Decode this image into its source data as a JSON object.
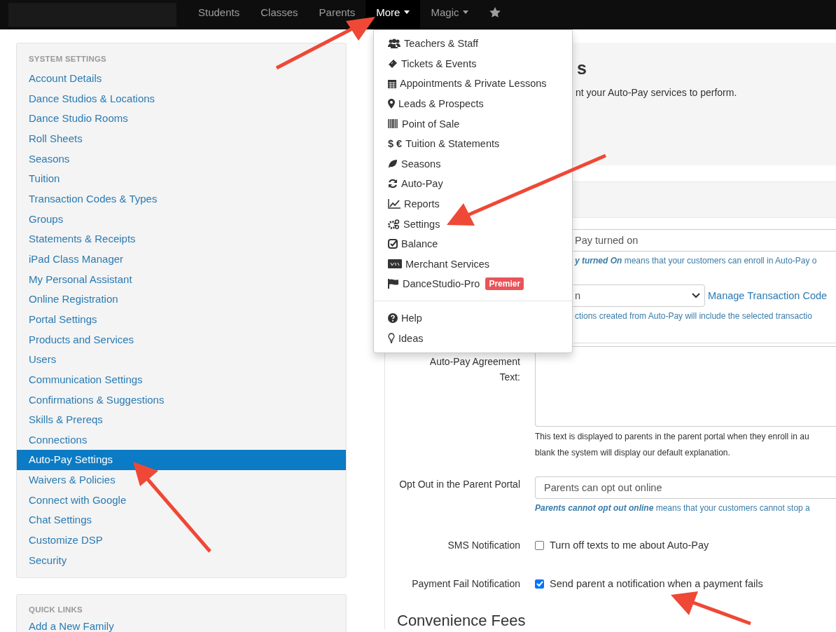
{
  "navbar": {
    "items": [
      {
        "label": "Students",
        "selected": false,
        "caret": false,
        "kind": "text"
      },
      {
        "label": "Classes",
        "selected": false,
        "caret": false,
        "kind": "text"
      },
      {
        "label": "Parents",
        "selected": false,
        "caret": false,
        "kind": "text"
      },
      {
        "label": "More",
        "selected": true,
        "caret": true,
        "kind": "text"
      },
      {
        "label": "Magic",
        "selected": false,
        "caret": true,
        "kind": "text"
      },
      {
        "kind": "star",
        "selected": false
      }
    ]
  },
  "more_menu": {
    "items": [
      {
        "label": "Teachers & Staff",
        "kind": "users"
      },
      {
        "label": "Tickets & Events",
        "kind": "ticket"
      },
      {
        "label": "Appointments & Private Lessons",
        "kind": "calendar"
      },
      {
        "label": "Leads & Prospects",
        "kind": "pin"
      },
      {
        "label": "Point of Sale",
        "kind": "barcode"
      },
      {
        "label": "Tuition & Statements",
        "kind": "money",
        "glyph": "$ €"
      },
      {
        "label": "Seasons",
        "kind": "leaf"
      },
      {
        "label": "Auto-Pay",
        "kind": "refresh"
      },
      {
        "label": "Reports",
        "kind": "chart"
      },
      {
        "label": "Settings",
        "kind": "gears"
      },
      {
        "label": "Balance",
        "kind": "check"
      },
      {
        "label": "Merchant Services",
        "kind": "card"
      },
      {
        "label": "DanceStudio-Pro",
        "kind": "flag",
        "badge": "Premier"
      }
    ],
    "footer_items": [
      {
        "label": "Help",
        "kind": "question"
      },
      {
        "label": "Ideas",
        "kind": "bulb"
      }
    ]
  },
  "sidebar": {
    "title": "SYSTEM SETTINGS",
    "items": [
      {
        "label": "Account Details",
        "selected": false
      },
      {
        "label": "Dance Studios & Locations",
        "selected": false
      },
      {
        "label": "Dance Studio Rooms",
        "selected": false
      },
      {
        "label": "Roll Sheets",
        "selected": false
      },
      {
        "label": "Seasons",
        "selected": false
      },
      {
        "label": "Tuition",
        "selected": false
      },
      {
        "label": "Transaction Codes & Types",
        "selected": false
      },
      {
        "label": "Groups",
        "selected": false
      },
      {
        "label": "Statements & Receipts",
        "selected": false
      },
      {
        "label": "iPad Class Manager",
        "selected": false
      },
      {
        "label": "My Personal Assistant",
        "selected": false
      },
      {
        "label": "Online Registration",
        "selected": false
      },
      {
        "label": "Portal Settings",
        "selected": false
      },
      {
        "label": "Products and Services",
        "selected": false
      },
      {
        "label": "Users",
        "selected": false
      },
      {
        "label": "Communication Settings",
        "selected": false
      },
      {
        "label": "Confirmations & Suggestions",
        "selected": false
      },
      {
        "label": "Skills & Prereqs",
        "selected": false
      },
      {
        "label": "Connections",
        "selected": false
      },
      {
        "label": "Auto-Pay Settings",
        "selected": true
      },
      {
        "label": "Waivers & Policies",
        "selected": false
      },
      {
        "label": "Connect with Google",
        "selected": false
      },
      {
        "label": "Chat Settings",
        "selected": false
      },
      {
        "label": "Customize DSP",
        "selected": false
      },
      {
        "label": "Security",
        "selected": false
      }
    ]
  },
  "quick_links": {
    "title": "QUICK LINKS",
    "items": [
      "Add a New Family"
    ]
  },
  "main": {
    "heading": "s",
    "description": "nt your Auto-Pay services to perform.",
    "status_select": {
      "value": "Pay turned on"
    },
    "status_help": {
      "emphasis": "y turned On",
      "text": " means that your customers can enroll in Auto-Pay o"
    },
    "code_select": {
      "value": "n"
    },
    "code_link": "Manage Transaction Code",
    "code_help": "ctions created from Auto-Pay will include the selected transactio",
    "agreement": {
      "label": "Auto-Pay Agreement Text:",
      "help": [
        "This text is displayed to parents in the parent portal when they enroll in au",
        "blank the system will display our default explanation."
      ]
    },
    "opt_out": {
      "label": "Opt Out in the Parent Portal",
      "value": "Parents can opt out online",
      "help_emphasis": "Parents cannot opt out online",
      "help_text": " means that your customers cannot stop a"
    },
    "checkboxes": [
      {
        "label": "SMS Notification",
        "text": "Turn off texts to me about Auto-Pay",
        "checked": false
      },
      {
        "label": "Payment Fail Notification",
        "text": "Send parent a notification when a payment fails",
        "checked": true
      }
    ],
    "section_heading": "Convenience Fees"
  }
}
